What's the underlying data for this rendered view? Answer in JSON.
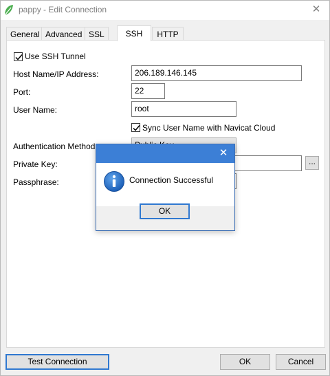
{
  "window": {
    "title": "pappy - Edit Connection",
    "close_glyph": "✕",
    "app_icon": "navicat-leaf-icon"
  },
  "tabs": [
    {
      "label": "General",
      "active": false
    },
    {
      "label": "Advanced",
      "active": false
    },
    {
      "label": "SSL",
      "active": false
    },
    {
      "label": "SSH",
      "active": true
    },
    {
      "label": "HTTP",
      "active": false
    }
  ],
  "ssh": {
    "use_tunnel_label": "Use SSH Tunnel",
    "use_tunnel_checked": true,
    "host_label": "Host Name/IP Address:",
    "host_value": "206.189.146.145",
    "port_label": "Port:",
    "port_value": "22",
    "user_label": "User Name:",
    "user_value": "root",
    "sync_label": "Sync User Name with Navicat Cloud",
    "sync_checked": true,
    "auth_label": "Authentication Method:",
    "auth_value": "Public Key",
    "private_key_label": "Private Key:",
    "private_key_value": "",
    "browse_label": "...",
    "passphrase_label": "Passphrase:"
  },
  "footer": {
    "test_label": "Test Connection",
    "ok_label": "OK",
    "cancel_label": "Cancel"
  },
  "dialog": {
    "close_glyph": "✕",
    "icon": "info-icon",
    "message": "Connection Successful",
    "ok_label": "OK"
  },
  "colors": {
    "dialog_title": "#3c7fd6",
    "focus_border": "#2f78d0"
  }
}
